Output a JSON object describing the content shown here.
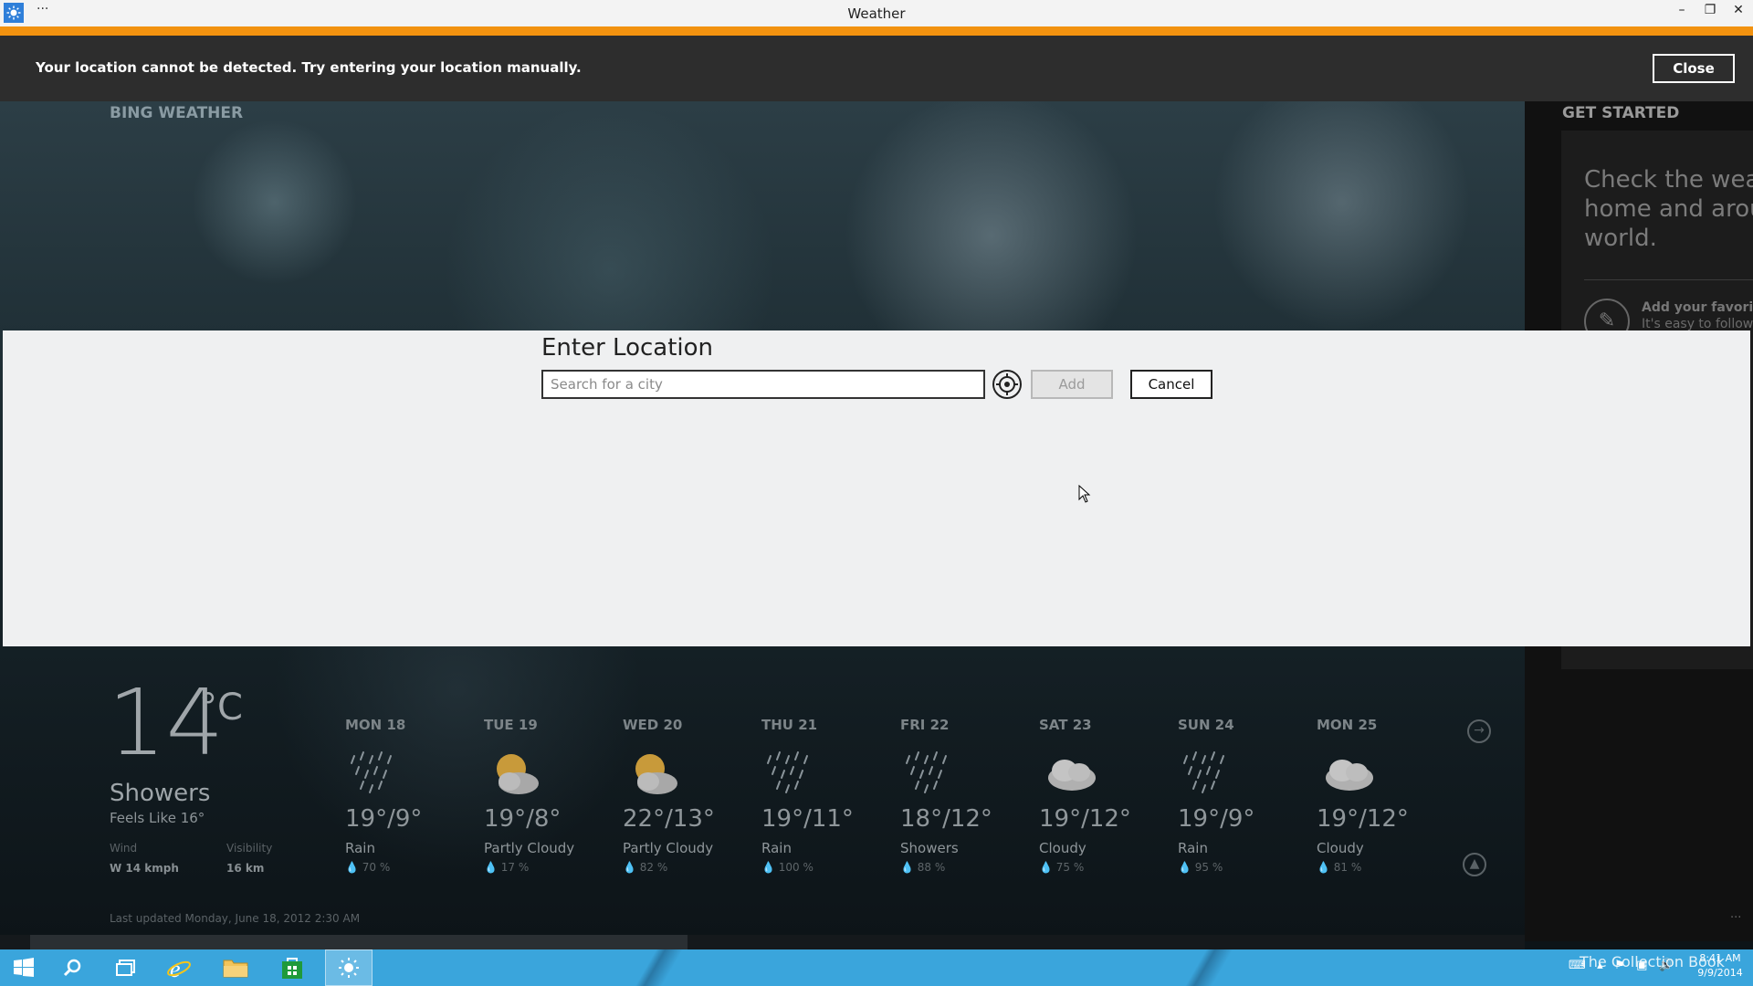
{
  "window": {
    "title": "Weather",
    "menu_glyph": "···"
  },
  "notification": {
    "message": "Your location cannot be detected. Try entering your location manually.",
    "close_label": "Close"
  },
  "app": {
    "brand": "BING WEATHER"
  },
  "side_panel": {
    "header": "GET STARTED",
    "body": "Check the weather at home and around the world.",
    "favorites_title": "Add your favorites",
    "favorites_sub": "It's easy to follow"
  },
  "dialog": {
    "title": "Enter Location",
    "search_placeholder": "Search for a city",
    "add_label": "Add",
    "cancel_label": "Cancel"
  },
  "current": {
    "temp": "14",
    "unit": "°C",
    "condition": "Showers",
    "feels_like": "Feels Like 16°",
    "wind_label": "Wind",
    "wind_value": "W 14 kmph",
    "visibility_label": "Visibility",
    "visibility_value": "16 km",
    "last_updated": "Last updated Monday, June 18, 2012 2:30 AM"
  },
  "forecast": [
    {
      "day": "MON 18",
      "range": "19°/9°",
      "desc": "Rain",
      "precip": "70 %",
      "icon": "rain-icon"
    },
    {
      "day": "TUE 19",
      "range": "19°/8°",
      "desc": "Partly Cloudy",
      "precip": "17 %",
      "icon": "partly-cloudy-icon"
    },
    {
      "day": "WED 20",
      "range": "22°/13°",
      "desc": "Partly Cloudy",
      "precip": "82 %",
      "icon": "partly-cloudy-icon"
    },
    {
      "day": "THU 21",
      "range": "19°/11°",
      "desc": "Rain",
      "precip": "100 %",
      "icon": "rain-icon"
    },
    {
      "day": "FRI 22",
      "range": "18°/12°",
      "desc": "Showers",
      "precip": "88 %",
      "icon": "rain-icon"
    },
    {
      "day": "SAT 23",
      "range": "19°/12°",
      "desc": "Cloudy",
      "precip": "75 %",
      "icon": "cloudy-icon"
    },
    {
      "day": "SUN 24",
      "range": "19°/9°",
      "desc": "Rain",
      "precip": "95 %",
      "icon": "rain-icon"
    },
    {
      "day": "MON 25",
      "range": "19°/12°",
      "desc": "Cloudy",
      "precip": "81 %",
      "icon": "cloudy-icon"
    }
  ],
  "taskbar": {
    "clock_time": "8:41 AM",
    "clock_date": "9/9/2014",
    "watermark": "The Collection Book"
  },
  "colors": {
    "accent": "#f2920f",
    "taskbar": "#3aa5dc",
    "notification_bg": "#2d2d2d",
    "dialog_bg": "#eff0f1"
  }
}
